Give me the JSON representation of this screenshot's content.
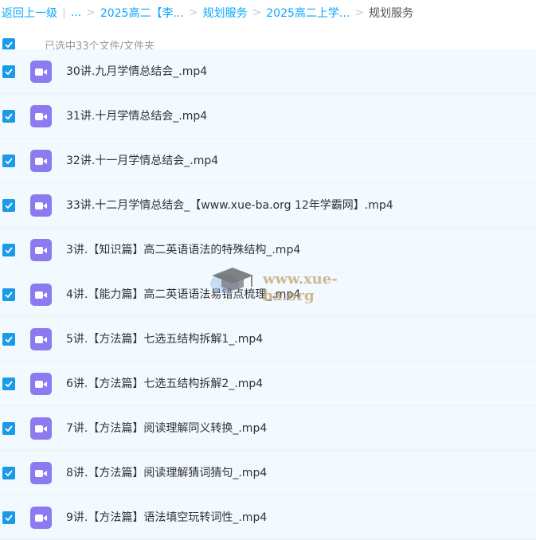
{
  "breadcrumb": {
    "back": "返回上一级",
    "sep_bar": "|",
    "ellipsis": "...",
    "item1": "2025高二【李...",
    "item2": "规划服务",
    "item3": "2025高二上学...",
    "current": "规划服务",
    "sep": ">"
  },
  "selection": {
    "text": "已选中33个文件/文件夹"
  },
  "files": [
    "30讲.九月学情总结会_.mp4",
    "31讲.十月学情总结会_.mp4",
    "32讲.十一月学情总结会_.mp4",
    "33讲.十二月学情总结会_【www.xue-ba.org 12年学霸网】.mp4",
    "3讲.【知识篇】高二英语语法的特殊结构_.mp4",
    "4讲.【能力篇】高二英语语法易错点梳理_.mp4",
    "5讲.【方法篇】七选五结构拆解1_.mp4",
    "6讲.【方法篇】七选五结构拆解2_.mp4",
    "7讲.【方法篇】阅读理解同义转换_.mp4",
    "8讲.【方法篇】阅读理解猜词猜句_.mp4",
    "9讲.【方法篇】语法填空玩转词性_.mp4"
  ],
  "icons": {
    "checkbox": "checkmark-icon",
    "file": "video-file-icon",
    "watermark": "graduation-cap-icon"
  },
  "watermark": {
    "text": "www.xue-ba.org"
  },
  "colors": {
    "link": "#06a7ff",
    "checkbox": "#1a9ae8",
    "video_icon": "#8c7bf0",
    "row_bg": "#f2f9ff"
  }
}
